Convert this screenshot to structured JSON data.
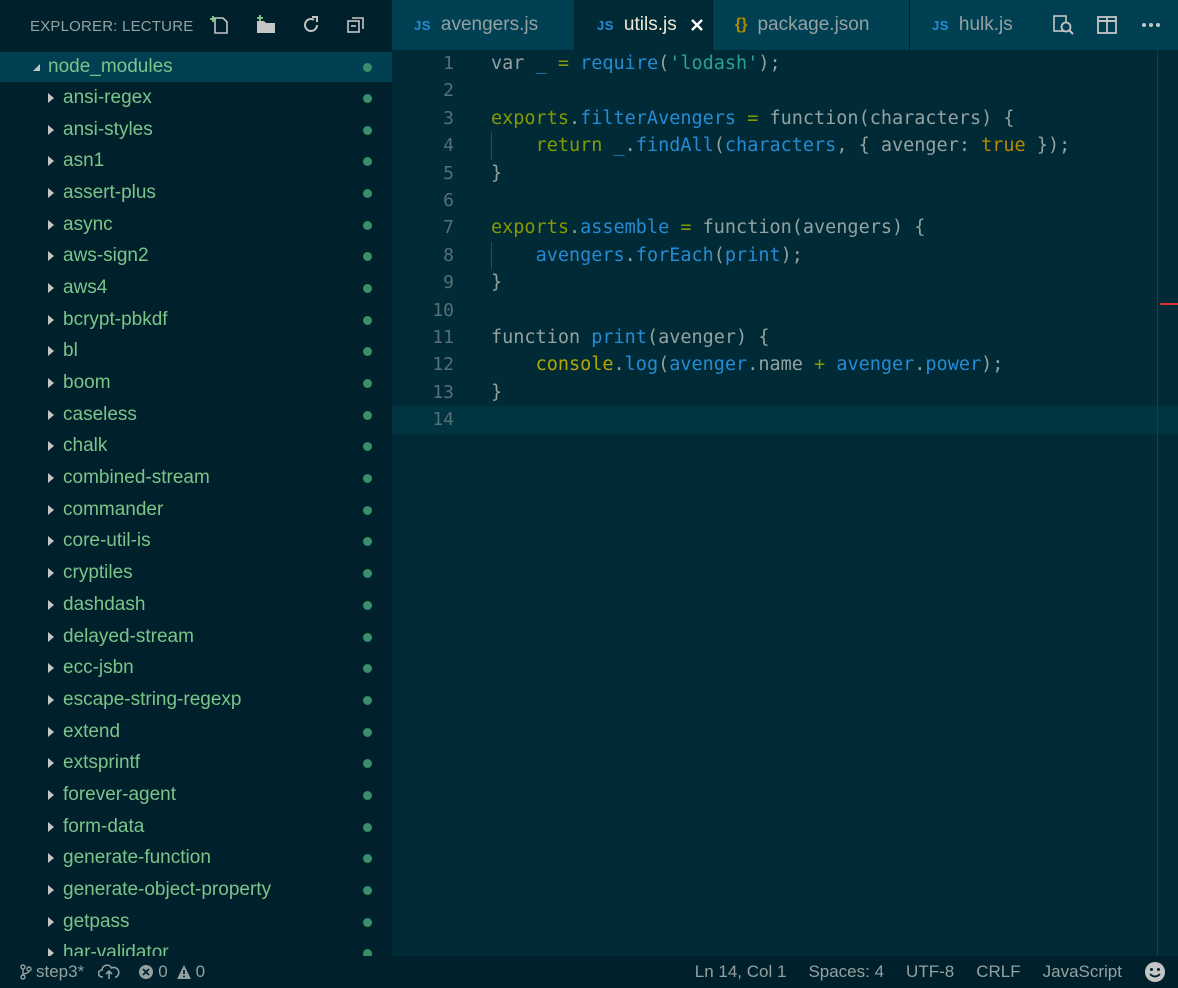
{
  "sidebar": {
    "title": "EXPLORER: LECTURE",
    "actions": [
      {
        "name": "new-file-icon"
      },
      {
        "name": "new-folder-icon"
      },
      {
        "name": "refresh-icon"
      },
      {
        "name": "collapse-all-icon"
      }
    ],
    "root": {
      "label": "node_modules",
      "expanded": true
    },
    "items": [
      {
        "label": "ansi-regex"
      },
      {
        "label": "ansi-styles"
      },
      {
        "label": "asn1"
      },
      {
        "label": "assert-plus"
      },
      {
        "label": "async"
      },
      {
        "label": "aws-sign2"
      },
      {
        "label": "aws4"
      },
      {
        "label": "bcrypt-pbkdf"
      },
      {
        "label": "bl"
      },
      {
        "label": "boom"
      },
      {
        "label": "caseless"
      },
      {
        "label": "chalk"
      },
      {
        "label": "combined-stream"
      },
      {
        "label": "commander"
      },
      {
        "label": "core-util-is"
      },
      {
        "label": "cryptiles"
      },
      {
        "label": "dashdash"
      },
      {
        "label": "delayed-stream"
      },
      {
        "label": "ecc-jsbn"
      },
      {
        "label": "escape-string-regexp"
      },
      {
        "label": "extend"
      },
      {
        "label": "extsprintf"
      },
      {
        "label": "forever-agent"
      },
      {
        "label": "form-data"
      },
      {
        "label": "generate-function"
      },
      {
        "label": "generate-object-property"
      },
      {
        "label": "getpass"
      },
      {
        "label": "har-validator"
      }
    ]
  },
  "tabs": [
    {
      "label": "avengers.js",
      "icon_text": "JS",
      "active": false
    },
    {
      "label": "utils.js",
      "icon_text": "JS",
      "active": true
    },
    {
      "label": "package.json",
      "icon_text": "{}",
      "active": false
    },
    {
      "label": "hulk.js",
      "icon_text": "JS",
      "active": false
    }
  ],
  "tab_actions": [
    {
      "name": "open-changes-icon"
    },
    {
      "name": "split-editor-icon"
    },
    {
      "name": "more-actions-icon"
    }
  ],
  "editor": {
    "current_line": 14,
    "lines": [
      {
        "n": "1",
        "tokens": [
          [
            "k",
            "var "
          ],
          [
            "v",
            "_"
          ],
          [
            "k",
            " "
          ],
          [
            "o",
            "="
          ],
          [
            "k",
            " "
          ],
          [
            "v",
            "require"
          ],
          [
            "k",
            "("
          ],
          [
            "s",
            "'lodash'"
          ],
          [
            "k",
            ");"
          ]
        ]
      },
      {
        "n": "2",
        "tokens": []
      },
      {
        "n": "3",
        "tokens": [
          [
            "g",
            "exports"
          ],
          [
            "k",
            "."
          ],
          [
            "v",
            "filterAvengers"
          ],
          [
            "k",
            " "
          ],
          [
            "o",
            "="
          ],
          [
            "k",
            " function(characters) {"
          ]
        ]
      },
      {
        "n": "4",
        "indent": true,
        "tokens": [
          [
            "k",
            "    "
          ],
          [
            "g",
            "return"
          ],
          [
            "k",
            " "
          ],
          [
            "v",
            "_"
          ],
          [
            "k",
            "."
          ],
          [
            "v",
            "findAll"
          ],
          [
            "k",
            "("
          ],
          [
            "v",
            "characters"
          ],
          [
            "k",
            ", { avenger: "
          ],
          [
            "b",
            "true"
          ],
          [
            "k",
            " });"
          ]
        ]
      },
      {
        "n": "5",
        "tokens": [
          [
            "k",
            "}"
          ]
        ]
      },
      {
        "n": "6",
        "tokens": []
      },
      {
        "n": "7",
        "tokens": [
          [
            "g",
            "exports"
          ],
          [
            "k",
            "."
          ],
          [
            "v",
            "assemble"
          ],
          [
            "k",
            " "
          ],
          [
            "o",
            "="
          ],
          [
            "k",
            " function(avengers) {"
          ]
        ]
      },
      {
        "n": "8",
        "indent": true,
        "tokens": [
          [
            "k",
            "    "
          ],
          [
            "v",
            "avengers"
          ],
          [
            "k",
            "."
          ],
          [
            "v",
            "forEach"
          ],
          [
            "k",
            "("
          ],
          [
            "v",
            "print"
          ],
          [
            "k",
            ");"
          ]
        ]
      },
      {
        "n": "9",
        "tokens": [
          [
            "k",
            "}"
          ]
        ]
      },
      {
        "n": "10",
        "tokens": []
      },
      {
        "n": "11",
        "tokens": [
          [
            "k",
            "function "
          ],
          [
            "v",
            "print"
          ],
          [
            "k",
            "(avenger) {"
          ]
        ]
      },
      {
        "n": "12",
        "tokens": [
          [
            "k",
            "    "
          ],
          [
            "y",
            "console"
          ],
          [
            "k",
            "."
          ],
          [
            "v",
            "log"
          ],
          [
            "k",
            "("
          ],
          [
            "v",
            "avenger"
          ],
          [
            "k",
            ".name "
          ],
          [
            "o",
            "+"
          ],
          [
            "k",
            " "
          ],
          [
            "v",
            "avenger"
          ],
          [
            "k",
            "."
          ],
          [
            "v",
            "power"
          ],
          [
            "k",
            ");"
          ]
        ]
      },
      {
        "n": "13",
        "tokens": [
          [
            "k",
            "}"
          ]
        ]
      },
      {
        "n": "14",
        "tokens": []
      }
    ]
  },
  "statusbar": {
    "branch": "step3*",
    "errors": "0",
    "warnings": "0",
    "position": "Ln 14, Col 1",
    "spaces": "Spaces: 4",
    "encoding": "UTF-8",
    "eol": "CRLF",
    "language": "JavaScript"
  },
  "colors": {
    "background": "#002b36",
    "sidebar": "#00212b",
    "tree_text": "#7bc48a",
    "keyword_green": "#859900",
    "identifier_blue": "#268bd2",
    "string_cyan": "#2aa198",
    "boolean_yellow": "#b58900"
  }
}
